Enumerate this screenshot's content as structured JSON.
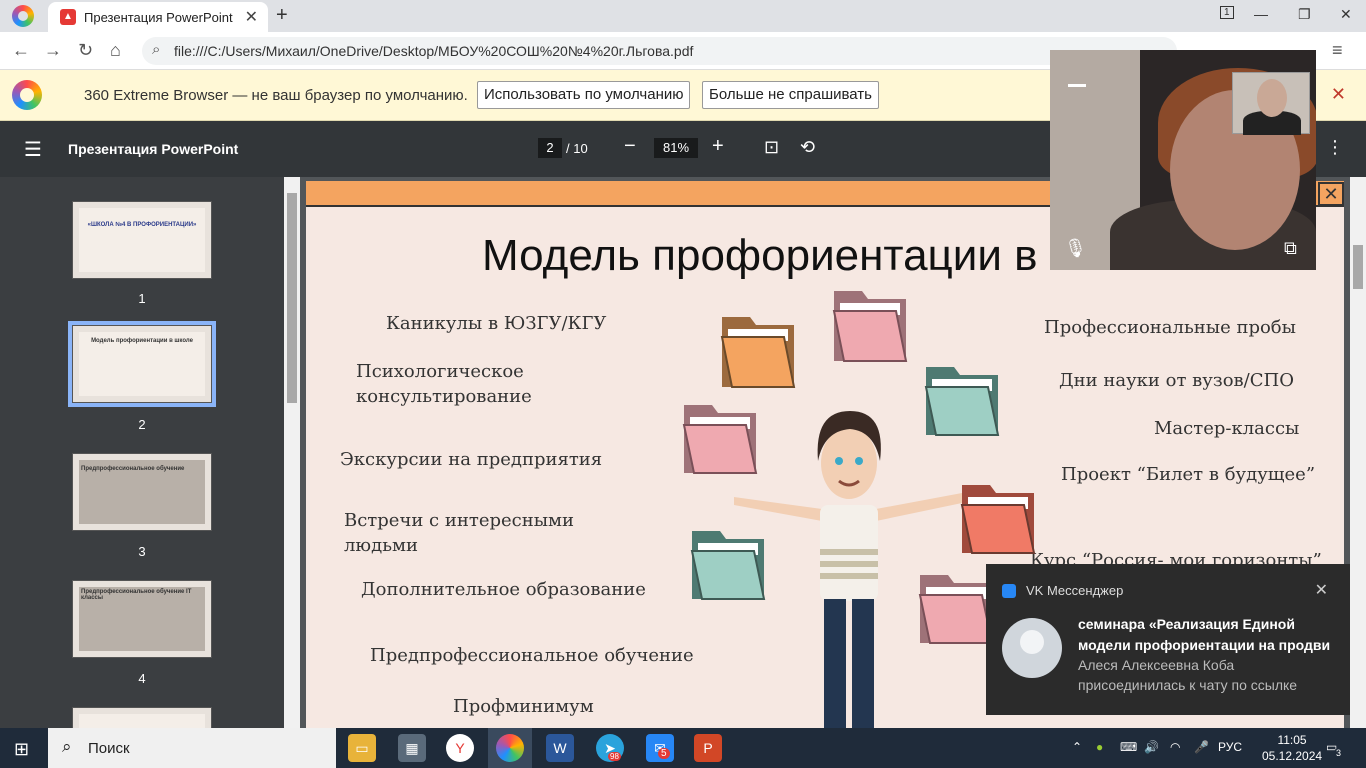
{
  "tab": {
    "title": "Презентация PowerPoint"
  },
  "address": {
    "url": "file:///C:/Users/Михаил/OneDrive/Desktop/МБОУ%20СОШ%20№4%20г.Льгова.pdf"
  },
  "infobar": {
    "message": "360 Extreme Browser — не ваш браузер по умолчанию.",
    "btn_default": "Использовать по умолчанию",
    "btn_never": "Больше не спрашивать"
  },
  "pdf": {
    "title": "Презентация PowerPoint",
    "page": "2",
    "total": "/ 10",
    "zoom": "81%"
  },
  "thumbnails": [
    {
      "num": "1",
      "title": "«ШКОЛА №4 В ПРОФОРИЕНТАЦИИ»"
    },
    {
      "num": "2",
      "title": "Модель профориентации в школе"
    },
    {
      "num": "3",
      "title": "Предпрофессиональное обучение"
    },
    {
      "num": "4",
      "title": "Предпрофессиональное обучение IT классы"
    }
  ],
  "slide": {
    "title": "Модель профориентации в",
    "left_items": [
      "Каникулы в ЮЗГУ/КГУ",
      "Психологическое",
      "консультирование",
      "Экскурсии на  предприятия",
      "Встречи с интересными",
      "людьми",
      "Дополнительное образование",
      "Предпрофессиональное обучение",
      "Профминимум"
    ],
    "right_items": [
      "Профессиональные пробы",
      "Дни науки от вузов/СПО",
      "Мастер-классы",
      "Проект “Билет в будущее”",
      "Курс “Россия- мои горизонты”"
    ]
  },
  "toast": {
    "app": "VK Мессенджер",
    "line1": "семинара «Реализация Единой",
    "line2": "модели профориентации на продви",
    "line3": "Алеся Алексеевна Коба",
    "line4": "присоединилась к чату по ссылке"
  },
  "taskbar": {
    "search": "Поиск",
    "lang": "РУС",
    "time": "11:05",
    "date": "05.12.2024",
    "notif_count": "3",
    "badge_telegram": "98",
    "badge_vk": "5"
  },
  "colors": {
    "accent": "#f4a460",
    "slide_bg": "#f6e8e2",
    "toolbar": "#323639"
  }
}
